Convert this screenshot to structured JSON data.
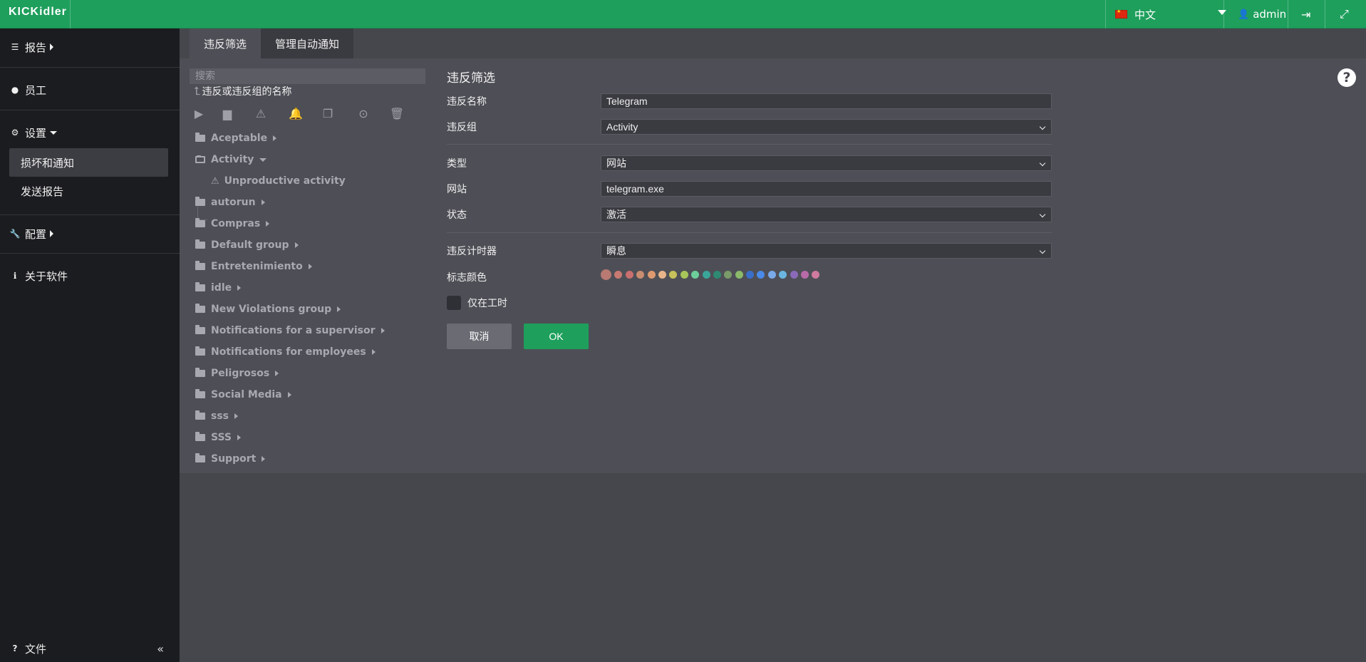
{
  "app": {
    "logo": "KICKidler"
  },
  "topbar": {
    "language": "中文",
    "user": "admin",
    "logout_icon": "logout-icon",
    "fullscreen_icon": "expand-icon"
  },
  "sidebar": {
    "reports": "报告",
    "employees": "员工",
    "settings": "设置",
    "sub_violations": "损坏和通知",
    "sub_send_reports": "发送报告",
    "config": "配置",
    "about": "关于软件",
    "files": "文件"
  },
  "tabs": [
    {
      "label": "违反筛选"
    },
    {
      "label": "管理自动通知"
    }
  ],
  "tree": {
    "search_placeholder": "搜索",
    "root_label": "违反或违反组的名称",
    "items": [
      {
        "label": "Aceptable"
      },
      {
        "label": "Activity"
      },
      {
        "label": "Unproductive activity"
      },
      {
        "label": "autorun"
      },
      {
        "label": "Compras"
      },
      {
        "label": "Default group"
      },
      {
        "label": "Entretenimiento"
      },
      {
        "label": "idle"
      },
      {
        "label": "New Violations group"
      },
      {
        "label": "Notifications for a supervisor"
      },
      {
        "label": "Notifications for employees"
      },
      {
        "label": "Peligrosos"
      },
      {
        "label": "Social Media"
      },
      {
        "label": "sss"
      },
      {
        "label": "SSS"
      },
      {
        "label": "Support"
      }
    ]
  },
  "form": {
    "title": "违反筛选",
    "fields": [
      {
        "label": "违反名称",
        "value": "Telegram"
      },
      {
        "label": "违反组",
        "value": "Activity"
      },
      {
        "label": "类型",
        "value": "网站"
      },
      {
        "label": "网站",
        "value": "telegram.exe"
      },
      {
        "label": "状态",
        "value": "激活"
      },
      {
        "label": "违反计时器",
        "value": "瞬息"
      }
    ],
    "color_label": "标志颜色",
    "colors": [
      "#b87a72",
      "#c77a72",
      "#c96f6f",
      "#c98d6f",
      "#dd9a70",
      "#e8b48a",
      "#c8c05a",
      "#a8c55a",
      "#6ccf9a",
      "#3aa69a",
      "#2f8a72",
      "#7b9a6a",
      "#8aba6a",
      "#3a6ec8",
      "#4a8ae8",
      "#7aaae8",
      "#6ab6e0",
      "#8a6ab8",
      "#b86aa8",
      "#d07aa0"
    ],
    "checkbox_label": "仅在工时",
    "cancel": "取消",
    "ok": "OK"
  }
}
